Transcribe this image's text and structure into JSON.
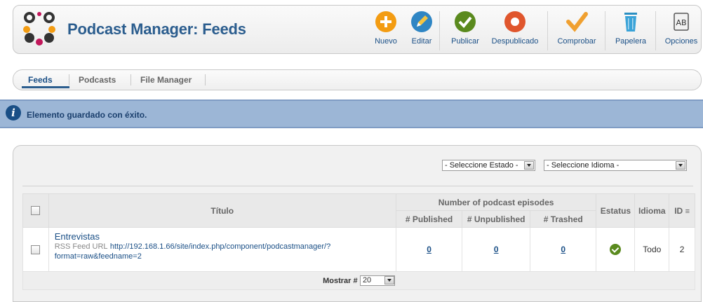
{
  "header": {
    "title": "Podcast Manager: Feeds",
    "toolbar": {
      "new": "Nuevo",
      "edit": "Editar",
      "publish": "Publicar",
      "unpublish": "Despublicado",
      "check": "Comprobar",
      "trash": "Papelera",
      "options": "Opciones"
    }
  },
  "subnav": {
    "tabs": [
      "Feeds",
      "Podcasts",
      "File Manager"
    ],
    "active": "Feeds"
  },
  "message": {
    "text": "Elemento guardado con éxito."
  },
  "filters": {
    "state": "- Seleccione Estado -",
    "language": "- Seleccione Idioma -"
  },
  "table": {
    "headers": {
      "title": "Título",
      "episodes_group": "Number of podcast episodes",
      "published": "# Published",
      "unpublished": "# Unpublished",
      "trashed": "# Trashed",
      "status": "Estatus",
      "language": "Idioma",
      "id": "ID"
    },
    "rows": [
      {
        "title": "Entrevistas",
        "rss_label": "RSS Feed URL",
        "rss_url_line1": "http://192.168.1.66/site/index.php/component/podcastmanager/?",
        "rss_url_line2": "format=raw&feedname=2",
        "published": "0",
        "unpublished": "0",
        "trashed": "0",
        "language": "Todo",
        "id": "2"
      }
    ],
    "footer": {
      "show_label": "Mostrar #",
      "show_value": "20"
    }
  },
  "colors": {
    "title": "#2b5d8e",
    "link": "#1a4f86",
    "message_bg": "#9cb6d6",
    "new": "#f39c12",
    "edit": "#2f86c4",
    "publish": "#5a8a1e",
    "unpublish": "#e0562d",
    "check": "#f0a030",
    "trash": "#3aa3d8"
  }
}
